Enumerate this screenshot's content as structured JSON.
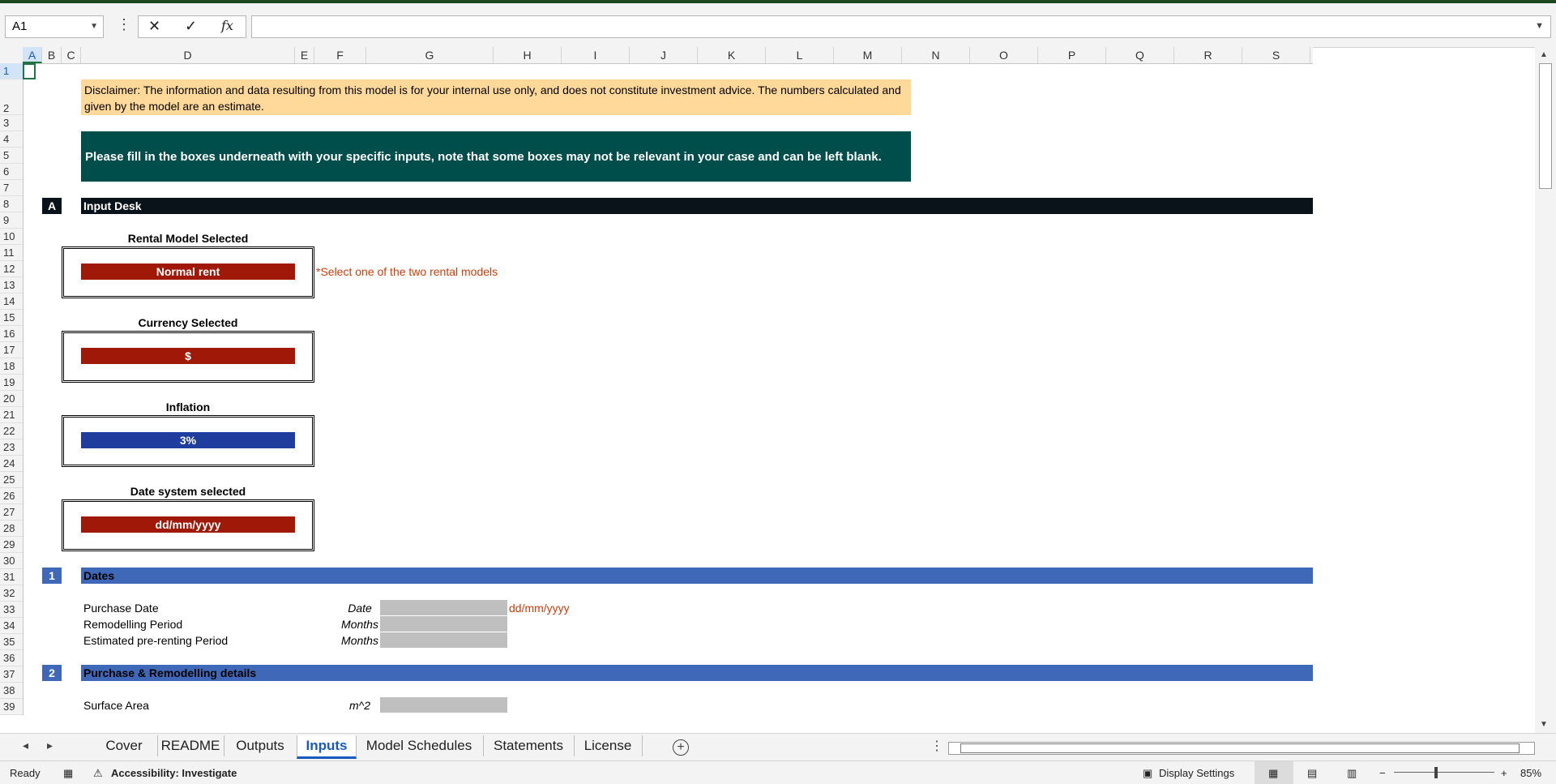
{
  "formula_bar": {
    "name_box": "A1",
    "cancel_icon": "✕",
    "enter_icon": "✓",
    "fx_label": "fx",
    "formula_value": ""
  },
  "columns": [
    "A",
    "B",
    "C",
    "D",
    "E",
    "F",
    "G",
    "H",
    "I",
    "J",
    "K",
    "L",
    "M",
    "N",
    "O",
    "P",
    "Q",
    "R",
    "S"
  ],
  "rows": [
    "1",
    "2",
    "3",
    "4",
    "5",
    "6",
    "7",
    "8",
    "9",
    "10",
    "11",
    "12",
    "13",
    "14",
    "15",
    "16",
    "17",
    "18",
    "19",
    "20",
    "21",
    "22",
    "23",
    "24",
    "25",
    "26",
    "27",
    "28",
    "29",
    "30",
    "31",
    "32",
    "33",
    "34",
    "35",
    "36",
    "37",
    "38",
    "39"
  ],
  "sheet": {
    "disclaimer": "Disclaimer: The information and data resulting from this model is for your internal use only, and does not constitute investment advice. The numbers calculated and given by the model are an estimate.",
    "banner": "Please fill in the boxes underneath with your specific inputs, note that some boxes may not be relevant in your case and can be left blank.",
    "section_a": {
      "num": "A",
      "title": "Input Desk"
    },
    "rental_model": {
      "title": "Rental Model Selected",
      "value": "Normal rent",
      "note": "*Select one of the two rental models"
    },
    "currency": {
      "title": "Currency  Selected",
      "value": "$"
    },
    "inflation": {
      "title": "Inflation",
      "value": "3%"
    },
    "date_system": {
      "title": "Date system selected",
      "value": "dd/mm/yyyy"
    },
    "section_1": {
      "num": "1",
      "title": "Dates"
    },
    "dates": [
      {
        "label": "Purchase Date",
        "unit": "Date",
        "note": "dd/mm/yyyy"
      },
      {
        "label": "Remodelling Period",
        "unit": "Months",
        "note": ""
      },
      {
        "label": "Estimated pre-renting Period",
        "unit": "Months",
        "note": ""
      }
    ],
    "section_2": {
      "num": "2",
      "title": "Purchase & Remodelling details"
    },
    "surface": {
      "label": "Surface Area",
      "unit": "m^2"
    }
  },
  "tabs": [
    "Cover",
    "README",
    "Outputs",
    "Inputs",
    "Model Schedules",
    "Statements",
    "License"
  ],
  "active_tab": "Inputs",
  "status": {
    "ready": "Ready",
    "accessibility": "Accessibility: Investigate",
    "display_settings": "Display Settings",
    "zoom": "85%"
  },
  "colors": {
    "section_dark": "#0b131a",
    "section_blue": "#4068b8",
    "banner": "#004e4c",
    "disclaimer": "#ffd99a",
    "red_input": "#a01808",
    "blue_input": "#1f3d9c",
    "note": "#d03c0a"
  }
}
